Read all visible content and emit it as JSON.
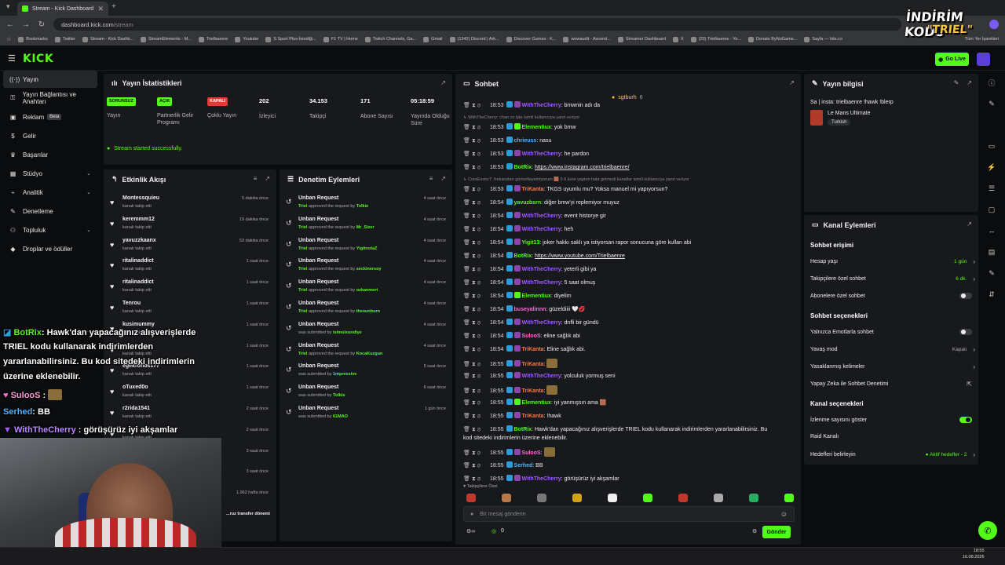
{
  "browser": {
    "tab_title": "Stream - Kick Dashboard",
    "tab_close": "✕",
    "new_tab": "+",
    "url_host": "dashboard.kick.com",
    "url_path": "/stream",
    "bookmarks": [
      "Bookmarks",
      "Twitter",
      "Stream - Kick Dashb...",
      "StreamElements - M...",
      "Trielbaenre",
      "Youtube",
      "S Sport Plus-İstediği...",
      "F1 TV | Home",
      "Twitch Channels, Ga...",
      "Gmail",
      "(1342) Discord | Ark...",
      "Discover Games - K...",
      "wowaudit - Ascend...",
      "Streamer Dashboard",
      "X",
      "(23) Trielbaenre - Yo...",
      "Donate ByNoGame...",
      "Sayfa — hits.co"
    ],
    "bookmarks_all": "Tüm Yer İşaretleri"
  },
  "header": {
    "logo": "KICK",
    "go_live": "Go Live"
  },
  "sidebar": {
    "items": [
      {
        "label": "Yayın",
        "icon": "broadcast-icon"
      },
      {
        "label": "Yayın Bağlantısı ve Anahtarı",
        "icon": "key-icon"
      },
      {
        "label": "Reklam",
        "badge": "Beta",
        "icon": "ad-icon"
      },
      {
        "label": "Gelir",
        "icon": "money-icon"
      },
      {
        "label": "Başarılar",
        "icon": "trophy-icon"
      },
      {
        "label": "Stüdyo",
        "icon": "studio-icon",
        "chevron": "⌄"
      },
      {
        "label": "Analitik",
        "icon": "chart-icon",
        "chevron": "⌄"
      },
      {
        "label": "Denetleme",
        "icon": "wrench-icon"
      },
      {
        "label": "Topluluk",
        "icon": "community-icon",
        "chevron": "⌄"
      },
      {
        "label": "Droplar ve ödüller",
        "icon": "gift-icon"
      }
    ]
  },
  "stats": {
    "title": "Yayın İstatistikleri",
    "items": [
      {
        "tag": "SORUNSUZ",
        "label": "Yayın"
      },
      {
        "tag": "AÇIK",
        "label": "Partnerlik Gelir Programı"
      },
      {
        "tag": "KAPALI",
        "label": "Çoklu Yayın"
      },
      {
        "value": "202",
        "label": "İzleyici"
      },
      {
        "value": "34.153",
        "label": "Takipçi"
      },
      {
        "value": "171",
        "label": "Abone Sayısı"
      },
      {
        "value": "05:18:59",
        "label": "Yayında Olduğu Süre"
      }
    ],
    "status_message": "Stream started successfully."
  },
  "activity": {
    "title": "Etkinlik Akışı",
    "items": [
      {
        "name": "Montessquieu",
        "sub": "kanalı takip etti",
        "time": "5 dakika önce"
      },
      {
        "name": "keremmm12",
        "sub": "kanalı takip etti",
        "time": "19 dakika önce"
      },
      {
        "name": "yavuzzkaanx",
        "sub": "kanalı takip etti",
        "time": "53 dakika önce"
      },
      {
        "name": "ritalinaddict",
        "sub": "kanalı takip etti",
        "time": "1 saat önce"
      },
      {
        "name": "ritalinaddict",
        "sub": "kanalı takip etti",
        "time": "1 saat önce"
      },
      {
        "name": "Tenrou",
        "sub": "kanalı takip etti",
        "time": "1 saat önce"
      },
      {
        "name": "kusimummy",
        "sub": "kanalı takip etti",
        "time": "1 saat önce"
      },
      {
        "name": "",
        "sub": "kanalı takip etti",
        "time": "1 saat önce"
      },
      {
        "name": "egekronos177",
        "sub": "kanalı takip etti",
        "time": "1 saat önce"
      },
      {
        "name": "oTuxed0o",
        "sub": "kanalı takip etti",
        "time": "1 saat önce"
      },
      {
        "name": "r2rida1541",
        "sub": "kanalı takip etti",
        "time": "2 saat önce"
      },
      {
        "name": "",
        "sub": "kanalı takip etti",
        "time": "2 saat önce"
      },
      {
        "name": "",
        "sub": "",
        "time": "3 saat önce"
      },
      {
        "name": "",
        "sub": "",
        "time": "3 saat önce"
      },
      {
        "name": "",
        "sub": "",
        "time": "1.962 hafta önce"
      },
      {
        "name": "",
        "sub": "",
        "time": "",
        "extra": "...ruz transfer dönemi"
      }
    ]
  },
  "moderation": {
    "title": "Denetim Eylemleri",
    "items": [
      {
        "name": "Unban Request",
        "actor": "Triel",
        "mid": "approved the request by",
        "target": "Tolkie",
        "time": "4 saat önce"
      },
      {
        "name": "Unban Request",
        "actor": "Triel",
        "mid": "approved the request by",
        "target": "Mr_Sizer",
        "time": "4 saat önce"
      },
      {
        "name": "Unban Request",
        "actor": "Triel",
        "mid": "approved the request by",
        "target": "YigitnotaZ",
        "time": "4 saat önce"
      },
      {
        "name": "Unban Request",
        "actor": "Triel",
        "mid": "approved the request by",
        "target": "seckinersoy",
        "time": "4 saat önce"
      },
      {
        "name": "Unban Request",
        "actor": "Triel",
        "mid": "approved the request by",
        "target": "ozkanmert",
        "time": "4 saat önce"
      },
      {
        "name": "Unban Request",
        "actor": "Triel",
        "mid": "approved the request by",
        "target": "thesunburn",
        "time": "4 saat önce"
      },
      {
        "name": "Unban Request",
        "actor": "",
        "mid": "was submitted by",
        "target": "isimolsundiye",
        "time": "4 saat önce"
      },
      {
        "name": "Unban Request",
        "actor": "Triel",
        "mid": "approved the request by",
        "target": "KocaKuzgun",
        "time": "4 saat önce"
      },
      {
        "name": "Unban Request",
        "actor": "",
        "mid": "was submitted by",
        "target": "1mpressive",
        "time": "5 saat önce"
      },
      {
        "name": "Unban Request",
        "actor": "",
        "mid": "was submitted by",
        "target": "Tolkie",
        "time": "6 saat önce"
      },
      {
        "name": "Unban Request",
        "actor": "",
        "mid": "was submitted by",
        "target": "61MAO",
        "time": "1 gün önce"
      }
    ]
  },
  "chat": {
    "title": "Sohbet",
    "pinned_user": "sgtburh",
    "pinned_count": "6",
    "lines": [
      {
        "type": "msg",
        "time": "18:53",
        "user": "WithTheCherry",
        "color": "#a35cff",
        "text": "bmwnin adı da",
        "badge": "v"
      },
      {
        "type": "reply",
        "text": "↳ WithTheCherry: chan co işte isimli kullanıcıya yanıt veriyor"
      },
      {
        "type": "msg",
        "time": "18:53",
        "user": "Elementiux",
        "color": "#53fc18",
        "text": "yok bmw",
        "badge": "g"
      },
      {
        "type": "msg",
        "time": "18:53",
        "user": "chrieuss",
        "color": "#4fb3ff",
        "text": "nasu",
        "badge": ""
      },
      {
        "type": "msg",
        "time": "18:53",
        "user": "WithTheCherry",
        "color": "#a35cff",
        "text": "he pardon",
        "badge": "v"
      },
      {
        "type": "link",
        "time": "18:53",
        "user": "BotRix",
        "color": "#53fc18",
        "text": "https://www.instagram.com/trielbaenre/",
        "badge": ""
      },
      {
        "type": "reply",
        "text": "↳ CoreExvirc7: frekansları güncelleyemiyorum 🟫 5 6 kere yaptım hala gelmedi kanallar isimli kullanıcıya yanıt veriyor"
      },
      {
        "type": "msg",
        "time": "18:53",
        "user": "TriKanta",
        "color": "#ff7a45",
        "text": "TKGS uyumlu mu? Yoksa manuel mi yapıyorsun?",
        "badge": "v"
      },
      {
        "type": "msg",
        "time": "18:54",
        "user": "yavuzbsrn",
        "color": "#53fc18",
        "text": "diğer bmw'yi replemiyor muyuz",
        "badge": ""
      },
      {
        "type": "msg",
        "time": "18:54",
        "user": "WithTheCherry",
        "color": "#a35cff",
        "text": "event historye gir",
        "badge": "v"
      },
      {
        "type": "msg",
        "time": "18:54",
        "user": "WithTheCherry",
        "color": "#a35cff",
        "text": "heh",
        "badge": "v"
      },
      {
        "type": "msg",
        "time": "18:54",
        "user": "Yigit13",
        "color": "#53fc18",
        "text": "joker hakkı saklı ya istiyorsan rapor sonucuna göre kullan abi",
        "badge": "v"
      },
      {
        "type": "link",
        "time": "18:54",
        "user": "BotRix",
        "color": "#53fc18",
        "text": "https://www.youtube.com/Trielbaenre",
        "badge": ""
      },
      {
        "type": "msg",
        "time": "18:54",
        "user": "WithTheCherry",
        "color": "#a35cff",
        "text": "yeterli gibi ya",
        "badge": "v"
      },
      {
        "type": "msg",
        "time": "18:54",
        "user": "WithTheCherry",
        "color": "#a35cff",
        "text": "5 saat olmuş",
        "badge": "v"
      },
      {
        "type": "msg",
        "time": "18:54",
        "user": "Elementiux",
        "color": "#53fc18",
        "text": "diyelim",
        "badge": "g"
      },
      {
        "type": "msg",
        "time": "18:54",
        "user": "buseyalinnn",
        "color": "#ff6ad5",
        "text": "güzeldiiii 🤍💋",
        "badge": ""
      },
      {
        "type": "msg",
        "time": "18:54",
        "user": "WithTheCherry",
        "color": "#a35cff",
        "text": "dnfli bir gündü",
        "badge": "v"
      },
      {
        "type": "msg",
        "time": "18:54",
        "user": "SulooS",
        "color": "#ff6ad5",
        "text": "eline sağlık abi",
        "badge": "v"
      },
      {
        "type": "msg",
        "time": "18:54",
        "user": "TriKanta",
        "color": "#ff7a45",
        "text": "Eline sağlık abi.",
        "badge": "v"
      },
      {
        "type": "emote",
        "time": "18:55",
        "user": "TriKanta",
        "color": "#ff7a45",
        "text": "",
        "badge": "v"
      },
      {
        "type": "msg",
        "time": "18:55",
        "user": "WithTheCherry",
        "color": "#a35cff",
        "text": "yolculuk yormuş seni",
        "badge": "v"
      },
      {
        "type": "emote",
        "time": "18:55",
        "user": "TriKanta",
        "color": "#ff7a45",
        "text": "",
        "badge": "v"
      },
      {
        "type": "msg",
        "time": "18:55",
        "user": "Elementiux",
        "color": "#53fc18",
        "text": "iyi yanmışsın ama 🟫",
        "badge": "g"
      },
      {
        "type": "msg",
        "time": "18:55",
        "user": "TriKanta",
        "color": "#ff7a45",
        "text": "!hawk",
        "badge": "v"
      },
      {
        "type": "msg",
        "time": "18:55",
        "user": "BotRix",
        "color": "#53fc18",
        "text": "Hawk'dan yapacağınız alışverişlerde TRIEL kodu kullanarak indirimlerden yararlanabilirsiniz. Bu",
        "badge": ""
      },
      {
        "type": "cont",
        "text": "kod sitedeki indirimlerin üzerine eklenebilir."
      },
      {
        "type": "emote",
        "time": "18:55",
        "user": "SulooS",
        "color": "#ff6ad5",
        "text": "",
        "badge": "v"
      },
      {
        "type": "msg",
        "time": "18:55",
        "user": "Serhed",
        "color": "#4fb3ff",
        "text": "BB",
        "badge": ""
      },
      {
        "type": "msg",
        "time": "18:55",
        "user": "WithTheCherry",
        "color": "#a35cff",
        "text": "görüşürüz iyi akşamlar",
        "badge": "v"
      }
    ],
    "followers_only": "Takipçilere Özel",
    "input_placeholder": "Bir mesaj gönderin",
    "points": "0",
    "send": "Gönder"
  },
  "stream_info": {
    "title": "Yayın bilgisi",
    "stream_title": "Sa | insta: trielbaenre !hawk !blerp",
    "category": "Le Mans Ultimate",
    "language": "Turkish"
  },
  "channel_actions": {
    "title": "Kanal Eylemleri",
    "sections": [
      {
        "heading": "Sohbet erişimi",
        "rows": [
          {
            "label": "Hesap yaşı",
            "value": "1 gün",
            "kind": "arrow"
          },
          {
            "label": "Takipçilere özel sohbet",
            "value": "6 dk.",
            "kind": "arrow"
          },
          {
            "label": "Abonelere özel sohbet",
            "value": "",
            "kind": "toggle-off"
          }
        ]
      },
      {
        "heading": "Sohbet seçenekleri",
        "rows": [
          {
            "label": "Yalnızca Emotlarla sohbet",
            "value": "",
            "kind": "toggle-off"
          },
          {
            "label": "Yavaş mod",
            "value": "Kapalı",
            "kind": "arrow"
          },
          {
            "label": "Yasaklanmış kelimeler",
            "value": "",
            "kind": "arrow"
          },
          {
            "label": "Yapay Zeka ile Sohbet Denetimi",
            "value": "",
            "kind": "external"
          }
        ]
      },
      {
        "heading": "Kanal seçenekleri",
        "rows": [
          {
            "label": "İzlenme sayısını göster",
            "value": "",
            "kind": "toggle-on"
          },
          {
            "label": "Raid Kanalı",
            "value": "",
            "kind": "none"
          },
          {
            "label": "Hedefleri belirleyin",
            "value": "● Aktif hedefler - 2",
            "kind": "arrow"
          }
        ]
      }
    ]
  },
  "overlay": {
    "promo_line1": "İNDİRİM KODU",
    "promo_line2": "\"TRIEL\"",
    "bot_name": "BotRix",
    "bot_line1": ": Hawk'dan yapacağınız alışverişlerde",
    "bot_line2": "TRIEL kodu kullanarak indirimlerden",
    "bot_line3": "yararlanabilirsiniz. Bu kod sitedeki indirimlerin",
    "bot_line4": "üzerine eklenebilir.",
    "user1": "SulooS",
    "user1_text": ":",
    "user2": "Serhed",
    "user2_text": ": BB",
    "user3": "WithTheCherry",
    "user3_text": ": görüşürüz iyi akşamlar"
  },
  "taskbar": {
    "time": "18:55",
    "date": "16.08.2026"
  }
}
